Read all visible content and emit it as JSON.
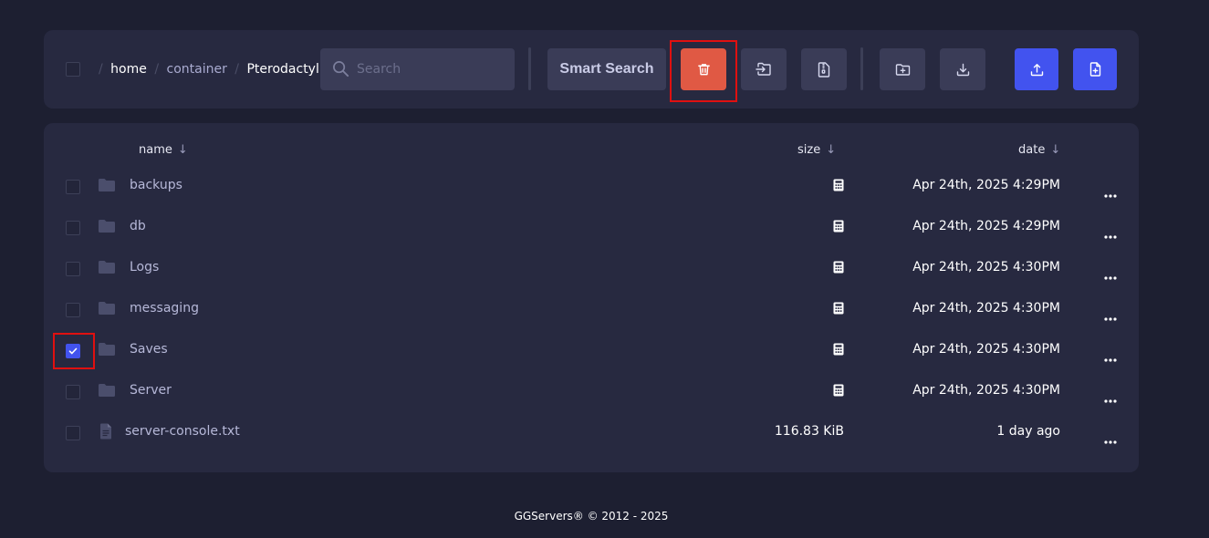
{
  "toolbar": {
    "breadcrumb": {
      "separator": "/",
      "items": [
        "home",
        "container",
        "Pterodactyl"
      ]
    },
    "search": {
      "placeholder": "Search",
      "value": ""
    },
    "smart_search_label": "Smart Search",
    "buttons": [
      "trash-icon",
      "move-file-icon",
      "archive-icon",
      "new-folder-icon",
      "download-icon",
      "upload-icon",
      "new-file-icon"
    ]
  },
  "filelist": {
    "columns": {
      "name": "name",
      "size": "size",
      "date": "date",
      "sort_arrow": "↓"
    },
    "rows": [
      {
        "name": "backups",
        "kind": "folder",
        "size": "",
        "date": "Apr 24th, 2025 4:29PM",
        "checked": false
      },
      {
        "name": "db",
        "kind": "folder",
        "size": "",
        "date": "Apr 24th, 2025 4:29PM",
        "checked": false
      },
      {
        "name": "Logs",
        "kind": "folder",
        "size": "",
        "date": "Apr 24th, 2025 4:30PM",
        "checked": false
      },
      {
        "name": "messaging",
        "kind": "folder",
        "size": "",
        "date": "Apr 24th, 2025 4:30PM",
        "checked": false
      },
      {
        "name": "Saves",
        "kind": "folder",
        "size": "",
        "date": "Apr 24th, 2025 4:30PM",
        "checked": true
      },
      {
        "name": "Server",
        "kind": "folder",
        "size": "",
        "date": "Apr 24th, 2025 4:30PM",
        "checked": false
      },
      {
        "name": "server-console.txt",
        "kind": "file",
        "size": "116.83 KiB",
        "date": "1 day ago",
        "checked": false
      }
    ]
  },
  "footer": {
    "text": "GGServers® © 2012 - 2025"
  },
  "colors": {
    "background": "#1d1f31",
    "panel": "#272940",
    "delete": "#e05944",
    "primary": "#4253ef",
    "highlight": "#e01010"
  }
}
